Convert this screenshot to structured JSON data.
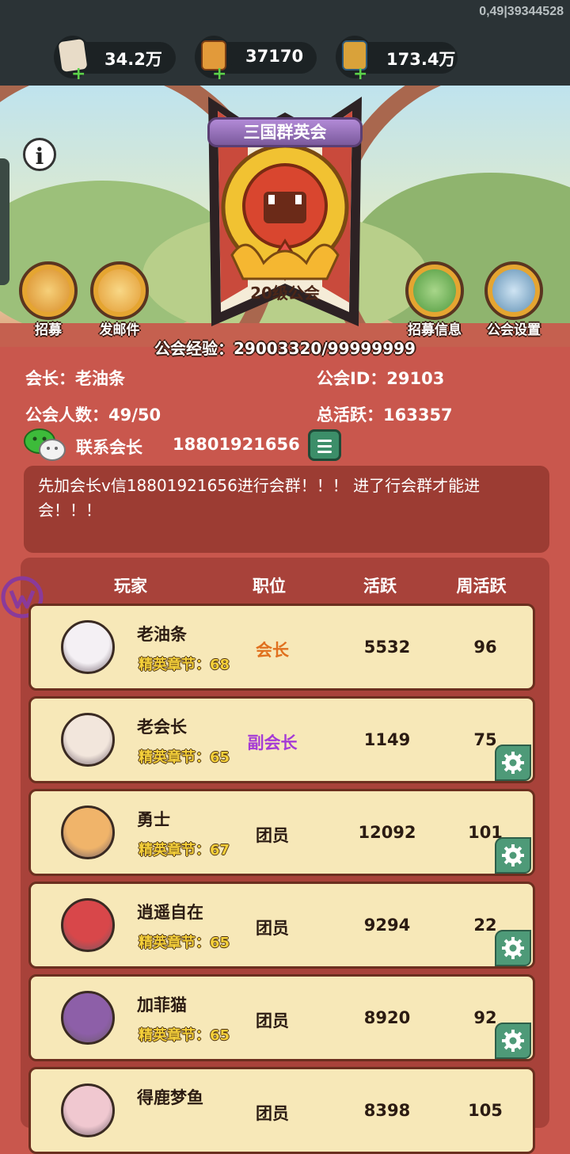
{
  "status": {
    "build_id": "0,49|39344528"
  },
  "resources": [
    {
      "value": "34.2万",
      "icon": "scroll-icon",
      "color": "#e8dcc8"
    },
    {
      "value": "37170",
      "icon": "battle-token-icon",
      "color": "#e29a3a"
    },
    {
      "value": "173.4万",
      "icon": "city-token-icon",
      "color": "#d9a23a"
    }
  ],
  "guild": {
    "name": "三国群英会",
    "level": "20级公会",
    "exp": "公会经验：29003320/99999999",
    "leader": "会长：老油条",
    "id": "公会ID：29103",
    "members": "公会人数：49/50",
    "total_active": "总活跃：163357",
    "contact_label": "联系会长",
    "contact_number": "18801921656",
    "notice": "先加会长v信18801921656进行会群！！！ 进了行会群才能进会！！！"
  },
  "actions": {
    "recruit": "招募",
    "mail": "发邮件",
    "recruit_info": "招募信息",
    "settings": "公会设置"
  },
  "table": {
    "headers": [
      "玩家",
      "职位",
      "活跃",
      "周活跃"
    ],
    "rows": [
      {
        "name": "老油条",
        "chapter": "精英章节：68",
        "position": "会长",
        "pos_color": "#e0701e",
        "active": "5532",
        "weekly": "96",
        "gear": false,
        "avatar_color": "#f4f0f4"
      },
      {
        "name": "老会长",
        "chapter": "精英章节：65",
        "position": "副会长",
        "pos_color": "#a53ad6",
        "active": "1149",
        "weekly": "75",
        "gear": true,
        "avatar_color": "#f2e6dc"
      },
      {
        "name": "勇士",
        "chapter": "精英章节：67",
        "position": "团员",
        "pos_color": "#2b1b12",
        "active": "12092",
        "weekly": "101",
        "gear": true,
        "avatar_color": "#f0b46a"
      },
      {
        "name": "逍遥自在",
        "chapter": "精英章节：65",
        "position": "团员",
        "pos_color": "#2b1b12",
        "active": "9294",
        "weekly": "22",
        "gear": true,
        "avatar_color": "#d8474a"
      },
      {
        "name": "加菲猫",
        "chapter": "精英章节：65",
        "position": "团员",
        "pos_color": "#2b1b12",
        "active": "8920",
        "weekly": "92",
        "gear": true,
        "avatar_color": "#8d5fa8"
      },
      {
        "name": "得鹿梦鱼",
        "chapter": "",
        "position": "团员",
        "pos_color": "#2b1b12",
        "active": "8398",
        "weekly": "105",
        "gear": false,
        "avatar_color": "#f0c8d0"
      }
    ]
  }
}
